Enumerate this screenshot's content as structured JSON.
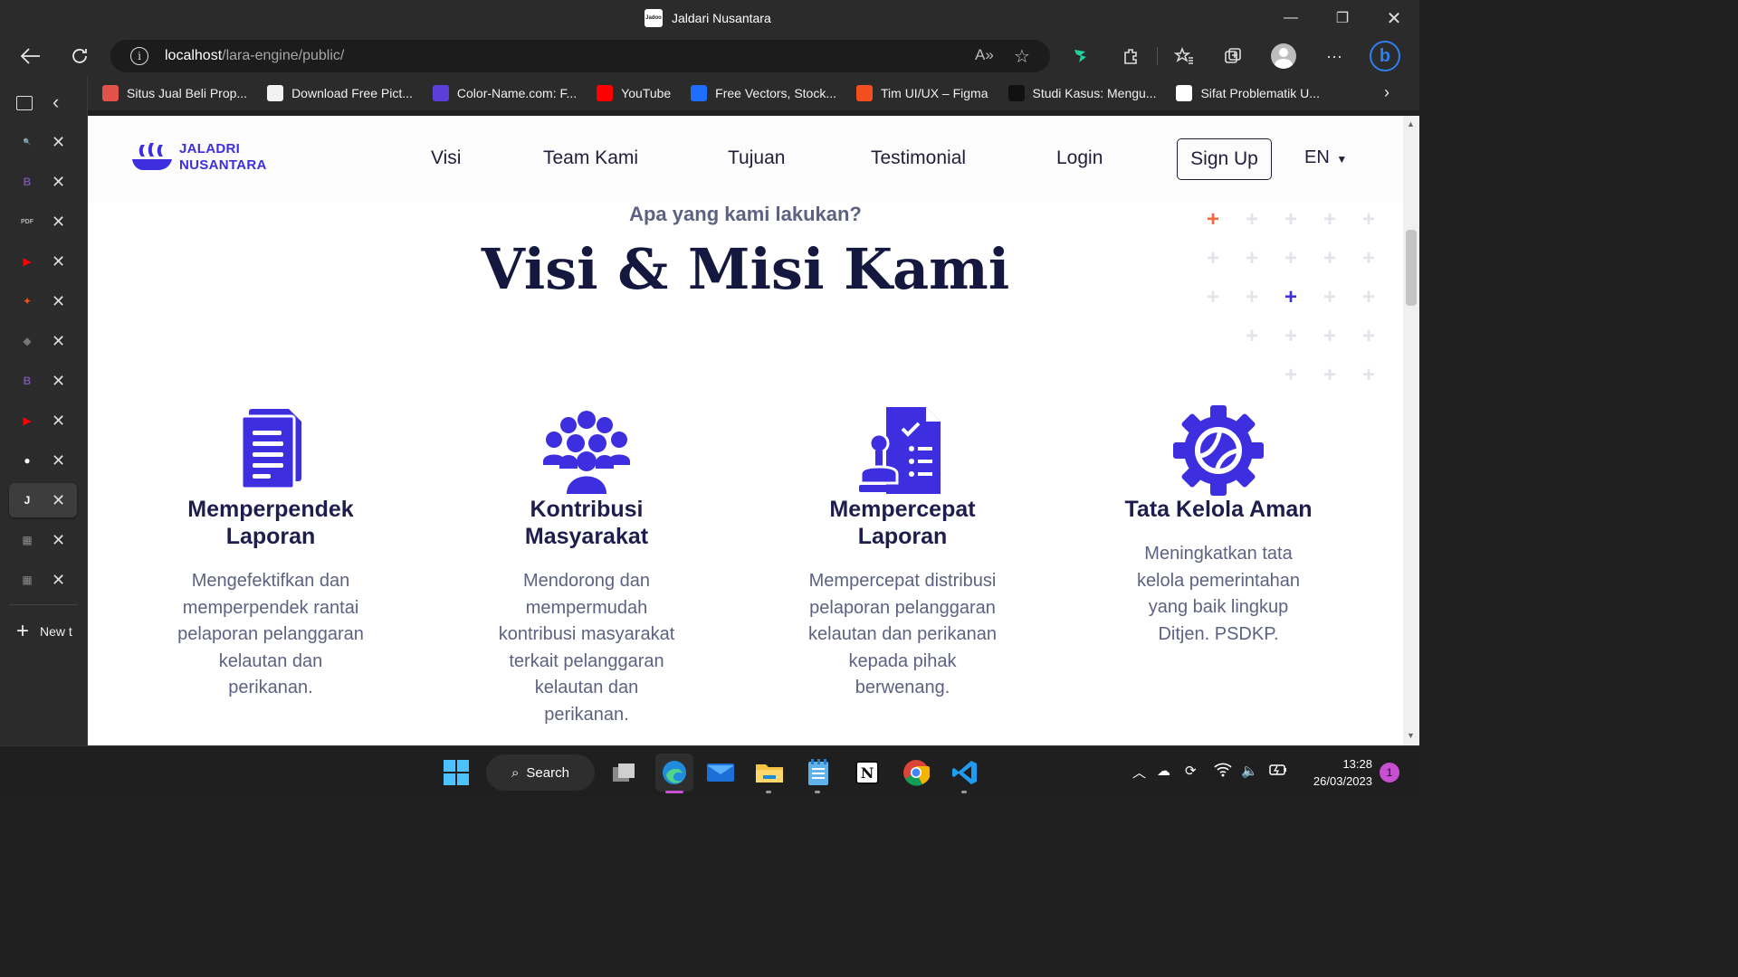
{
  "window": {
    "title": "Jaldari Nusantara",
    "favicon_text": "Jadoo",
    "controls": [
      "minimize",
      "restore",
      "close"
    ]
  },
  "address_bar": {
    "host": "localhost",
    "path": "/lara-engine/public/"
  },
  "bookmarks": [
    {
      "label": "Situs Jual Beli Prop...",
      "icon_color": "#e2524a"
    },
    {
      "label": "Download Free Pict...",
      "icon_color": "#f2f2f2"
    },
    {
      "label": "Color-Name.com: F...",
      "icon_color": "#5a3fd9"
    },
    {
      "label": "YouTube",
      "icon_color": "#ff0000"
    },
    {
      "label": "Free Vectors, Stock...",
      "icon_color": "#1f6fff"
    },
    {
      "label": "Tim UI/UX – Figma",
      "icon_color": "#f24e1e"
    },
    {
      "label": "Studi Kasus: Mengu...",
      "icon_color": "#111111"
    },
    {
      "label": "Sifat Problematik U...",
      "icon_color": "#ffffff"
    }
  ],
  "vertical_tabs": {
    "items": [
      {
        "icon": "search-icon",
        "color": "#2b7de9",
        "glyph": "🔍"
      },
      {
        "icon": "bootstrap-icon",
        "color": "#7952b3",
        "glyph": "B"
      },
      {
        "icon": "pdf-icon",
        "color": "#b5b5b5",
        "glyph": "PDF"
      },
      {
        "icon": "youtube-icon",
        "color": "#ff0000",
        "glyph": "▶"
      },
      {
        "icon": "figma-icon",
        "color": "#f24e1e",
        "glyph": "✦"
      },
      {
        "icon": "layers-icon",
        "color": "#777777",
        "glyph": "◆"
      },
      {
        "icon": "bootstrap-icon",
        "color": "#7952b3",
        "glyph": "B"
      },
      {
        "icon": "youtube-icon",
        "color": "#ff0000",
        "glyph": "▶"
      },
      {
        "icon": "github-icon",
        "color": "#ffffff",
        "glyph": "●"
      },
      {
        "icon": "jadoo-icon",
        "color": "#ffffff",
        "glyph": "J",
        "active": true
      },
      {
        "icon": "calendar-icon",
        "color": "#8a8a8a",
        "glyph": "▦"
      },
      {
        "icon": "calendar-icon",
        "color": "#8a8a8a",
        "glyph": "▦"
      }
    ],
    "new_tab_label": "New t"
  },
  "site": {
    "logo_line1": "JALADRI",
    "logo_line2": "NUSANTARA",
    "brand_color": "#3d2fe0",
    "menu": [
      "Visi",
      "Team Kami",
      "Tujuan",
      "Testimonial",
      "Login"
    ],
    "signup_label": "Sign Up",
    "lang_label": "EN",
    "kicker": "Apa yang kami lakukan?",
    "headline": "Visi & Misi Kami",
    "cards": [
      {
        "icon": "document-icon",
        "title_line1": "Memperpendek",
        "title_line2": "Laporan",
        "text_lines": [
          "Mengefektifkan dan",
          "memperpendek rantai",
          "pelaporan pelanggaran",
          "kelautan dan",
          "perikanan."
        ]
      },
      {
        "icon": "community-icon",
        "title_line1": "Kontribusi",
        "title_line2": "Masyarakat",
        "text_lines": [
          "Mendorong dan",
          "mempermudah",
          "kontribusi masyarakat",
          "terkait pelanggaran",
          "kelautan dan",
          "perikanan."
        ]
      },
      {
        "icon": "checklist-stamp-icon",
        "title_line1": "Mempercepat",
        "title_line2": "Laporan",
        "text_lines": [
          "Mempercepat distribusi",
          "pelaporan pelanggaran",
          "kelautan dan perikanan",
          "kepada pihak",
          "berwenang."
        ]
      },
      {
        "icon": "gear-globe-icon",
        "title_line1": "Tata Kelola Aman",
        "title_line2": "",
        "text_lines": [
          "Meningkatkan tata",
          "kelola pemerintahan",
          "yang baik lingkup",
          "Ditjen. PSDKP."
        ]
      }
    ]
  },
  "taskbar": {
    "search_label": "Search",
    "time": "13:28",
    "date": "26/03/2023",
    "notification_count": "1"
  }
}
